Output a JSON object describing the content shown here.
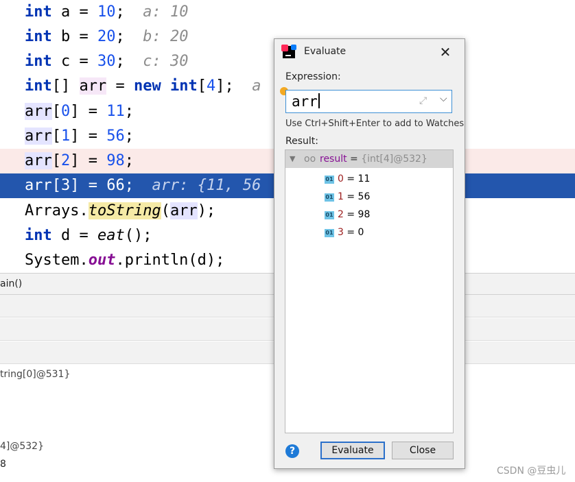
{
  "code_lines": [
    {
      "kw": "int",
      "var": " a = ",
      "num": "10",
      "tail": ";",
      "hint": "a: 10"
    },
    {
      "kw": "int",
      "var": " b = ",
      "num": "20",
      "tail": ";",
      "hint": "b: 20"
    },
    {
      "kw": "int",
      "var": " c = ",
      "num": "30",
      "tail": ";",
      "hint": "c: 30"
    },
    {
      "kw": "int",
      "post": "[] ",
      "arr": "arr",
      "eq": " = ",
      "new": "new",
      "sp": " ",
      "kw2": "int",
      "open": "[",
      "num": "4",
      "close": "];",
      "hint": "a"
    },
    {
      "arr": "arr",
      "open": "[",
      "idx": "0",
      "mid": "] = ",
      "num": "11",
      "tail": ";"
    },
    {
      "arr": "arr",
      "open": "[",
      "idx": "1",
      "mid": "] = ",
      "num": "56",
      "tail": ";"
    },
    {
      "arr": "arr",
      "open": "[",
      "idx": "2",
      "mid": "] = ",
      "num": "98",
      "tail": ";"
    },
    {
      "arr": "arr",
      "open": "[",
      "idx": "3",
      "mid": "] = ",
      "num": "66",
      "tail": ";",
      "hint": "arr: {11, 56"
    },
    {
      "cls": "Arrays.",
      "method": "toString",
      "open": "(",
      "arg": "arr",
      "close": ");"
    },
    {
      "kw": "int",
      "var": " d = ",
      "method": "eat",
      "close": "();"
    },
    {
      "cls": "System.",
      "field": "out",
      "rest": ".println(d);"
    }
  ],
  "frames_label": "ain()",
  "vars": {
    "args_value": "tring[0]@531}",
    "arr_value": "4]@532}",
    "last_value": "8"
  },
  "dialog": {
    "title": "Evaluate",
    "close_glyph": "✕",
    "expression_label": "Expression:",
    "expression_value": "arr",
    "watch_hint": "Use Ctrl+Shift+Enter to add to Watches",
    "result_label": "Result:",
    "result": {
      "name": "result",
      "eq": " = ",
      "value": "{int[4]@532}",
      "items": [
        {
          "index": "0",
          "value": " = 11"
        },
        {
          "index": "1",
          "value": " = 56"
        },
        {
          "index": "2",
          "value": " = 98"
        },
        {
          "index": "3",
          "value": " = 0"
        }
      ]
    },
    "badge_text": "01",
    "help_glyph": "?",
    "evaluate_label": "Evaluate",
    "close_label": "Close"
  },
  "watermark": "CSDN @豆虫儿",
  "colors": {
    "current_line": "#2356ad",
    "breakpoint_line": "#fbeae8",
    "keyword": "#0033b3",
    "number": "#1750eb",
    "accent": "#2a6fca"
  }
}
